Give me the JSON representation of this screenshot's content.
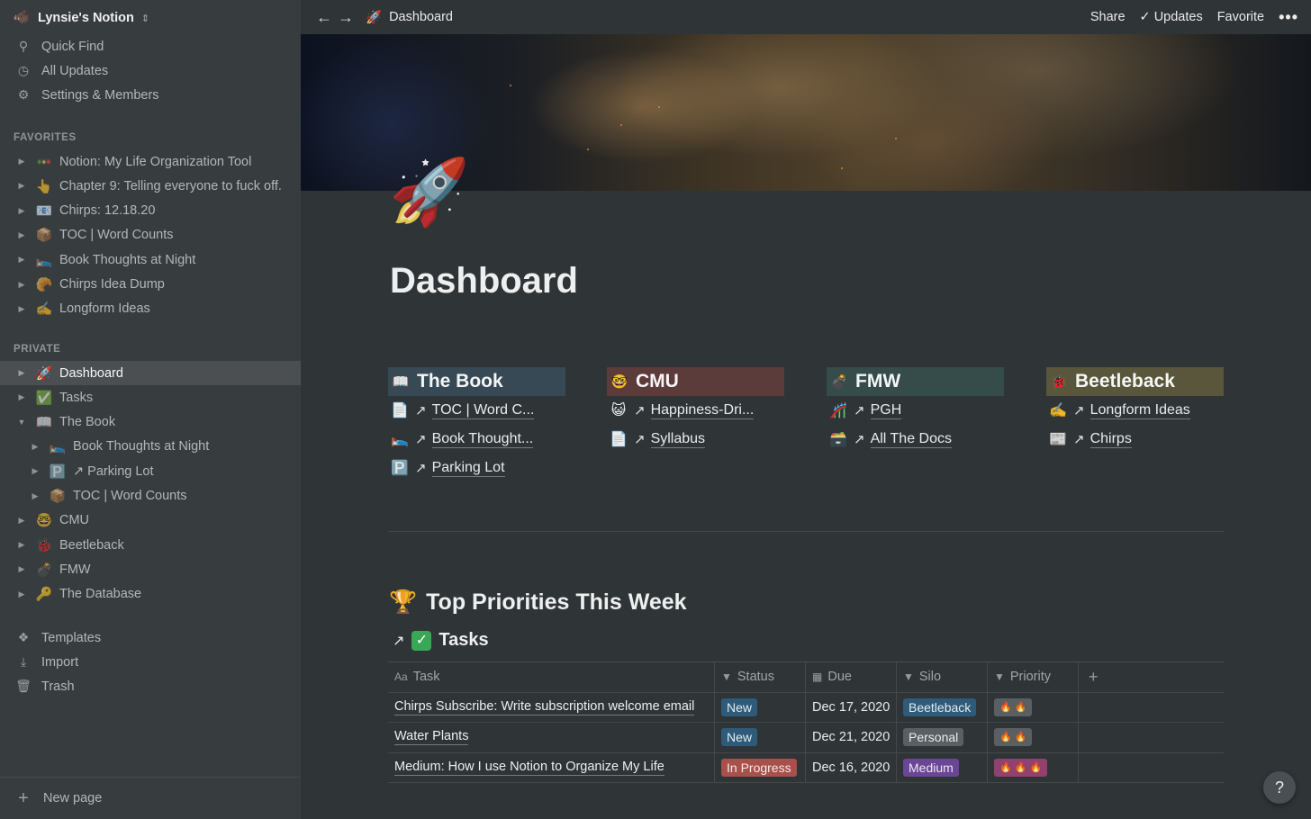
{
  "workspace": {
    "name": "Lynsie's Notion",
    "icon": "🐗"
  },
  "sidebar": {
    "top_items": [
      {
        "icon": "search-icon",
        "glyph": "⚲",
        "label": "Quick Find"
      },
      {
        "icon": "clock-icon",
        "glyph": "◷",
        "label": "All Updates"
      },
      {
        "icon": "gear-icon",
        "glyph": "⚙",
        "label": "Settings & Members"
      }
    ],
    "favorites_label": "FAVORITES",
    "favorites": [
      {
        "emoji": "🚥",
        "label": "Notion: My Life Organization Tool"
      },
      {
        "emoji": "👆",
        "label": "Chapter 9: Telling everyone to fuck off."
      },
      {
        "emoji": "📧",
        "label": "Chirps: 12.18.20"
      },
      {
        "emoji": "📦",
        "label": "TOC | Word Counts"
      },
      {
        "emoji": "🛌",
        "label": "Book Thoughts at Night"
      },
      {
        "emoji": "🥐",
        "label": "Chirps Idea Dump"
      },
      {
        "emoji": "✍️",
        "label": "Longform Ideas"
      }
    ],
    "private_label": "PRIVATE",
    "private": [
      {
        "emoji": "🚀",
        "label": "Dashboard",
        "depth": 0,
        "open": false,
        "active": true
      },
      {
        "emoji": "✅",
        "label": "Tasks",
        "depth": 0,
        "open": false
      },
      {
        "emoji": "📖",
        "label": "The Book",
        "depth": 0,
        "open": true
      },
      {
        "emoji": "🛌",
        "label": "Book Thoughts at Night",
        "depth": 1,
        "open": false
      },
      {
        "emoji": "🅿️",
        "label": "↗ Parking Lot",
        "depth": 1,
        "open": false
      },
      {
        "emoji": "📦",
        "label": "TOC | Word Counts",
        "depth": 1,
        "open": false
      },
      {
        "emoji": "🤓",
        "label": "CMU",
        "depth": 0,
        "open": false
      },
      {
        "emoji": "🐞",
        "label": "Beetleback",
        "depth": 0,
        "open": false
      },
      {
        "emoji": "💣",
        "label": "FMW",
        "depth": 0,
        "open": false
      },
      {
        "emoji": "🔑",
        "label": "The Database",
        "depth": 0,
        "open": false
      }
    ],
    "bottom_items": [
      {
        "icon": "templates-icon",
        "glyph": "❖",
        "label": "Templates"
      },
      {
        "icon": "import-icon",
        "glyph": "⤓",
        "label": "Import"
      },
      {
        "icon": "trash-icon",
        "glyph": "🗑",
        "label": "Trash"
      }
    ],
    "new_page": "New page"
  },
  "topbar": {
    "breadcrumb_icon": "🚀",
    "breadcrumb": "Dashboard",
    "share": "Share",
    "updates": "Updates",
    "favorite": "Favorite",
    "more": "•••"
  },
  "page": {
    "icon": "🚀",
    "title": "Dashboard"
  },
  "columns": [
    {
      "title": "The Book",
      "icon": "📖",
      "color": "#364954",
      "links": [
        {
          "icon": "📄",
          "label": "TOC | Word C..."
        },
        {
          "icon": "🛌",
          "label": "Book Thought..."
        },
        {
          "icon": "🅿️",
          "label": "Parking Lot"
        }
      ]
    },
    {
      "title": "CMU",
      "icon": "🤓",
      "color": "#5c3b3b",
      "links": [
        {
          "icon": "😺",
          "label": "Happiness-Dri..."
        },
        {
          "icon": "📄",
          "label": "Syllabus"
        }
      ]
    },
    {
      "title": "FMW",
      "icon": "💣",
      "color": "#354c4b",
      "links": [
        {
          "icon": "🎢",
          "label": "PGH"
        },
        {
          "icon": "🗃️",
          "label": "All The Docs"
        }
      ]
    },
    {
      "title": "Beetleback",
      "icon": "🐞",
      "color": "#59563b",
      "links": [
        {
          "icon": "✍️",
          "label": "Longform Ideas"
        },
        {
          "icon": "📰",
          "label": "Chirps"
        }
      ]
    }
  ],
  "priorities": {
    "icon": "🏆",
    "title": "Top Priorities This Week"
  },
  "tasks_link": {
    "title": "Tasks"
  },
  "table": {
    "headers": {
      "task": {
        "icon": "Aa",
        "label": "Task"
      },
      "status": {
        "icon": "▼",
        "label": "Status"
      },
      "due": {
        "icon": "▦",
        "label": "Due"
      },
      "silo": {
        "icon": "▼",
        "label": "Silo"
      },
      "priority": {
        "icon": "▼",
        "label": "Priority"
      },
      "add": "+"
    },
    "rows": [
      {
        "task": "Chirps Subscribe: Write subscription welcome email",
        "status": "New",
        "status_color": "#2e5b7a",
        "due": "Dec 17, 2020",
        "silo": "Beetleback",
        "silo_color": "#2e5b7a",
        "priority": "🔥 🔥",
        "priority_color": "#5a5f63"
      },
      {
        "task": "Water Plants",
        "status": "New",
        "status_color": "#2e5b7a",
        "due": "Dec 21, 2020",
        "silo": "Personal",
        "silo_color": "#5a5f63",
        "priority": "🔥 🔥",
        "priority_color": "#5a5f63"
      },
      {
        "task": "Medium: How I use Notion to Organize My Life",
        "status": "In Progress",
        "status_color": "#a8504a",
        "due": "Dec 16, 2020",
        "silo": "Medium",
        "silo_color": "#6b4596",
        "priority": "🔥 🔥 🔥",
        "priority_color": "#91416e"
      }
    ]
  },
  "help": "?"
}
